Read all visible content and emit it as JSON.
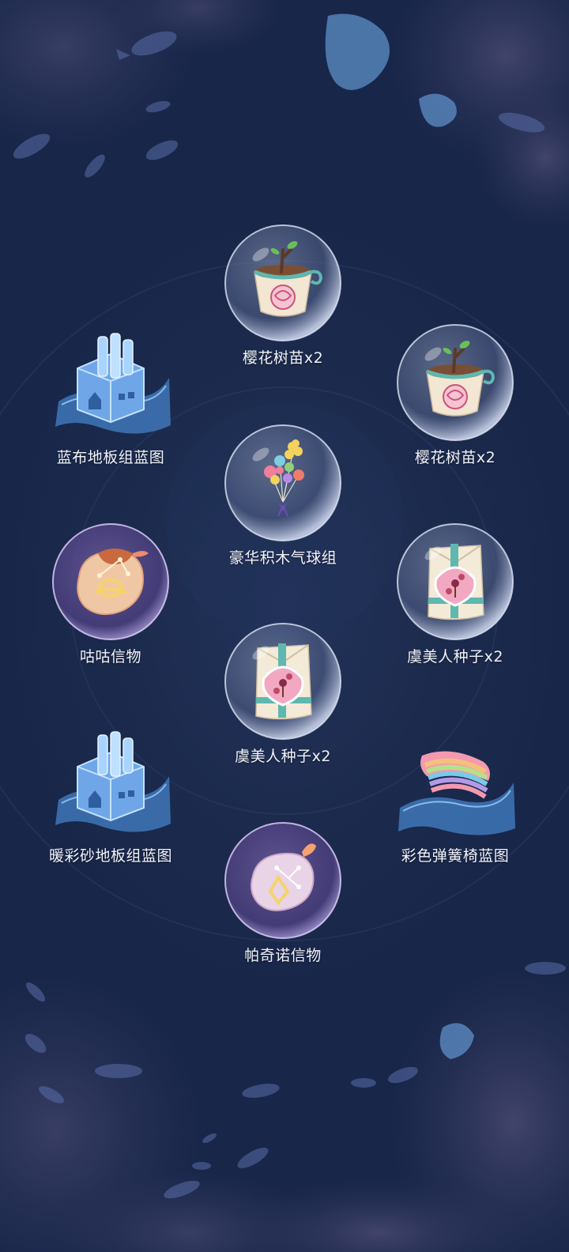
{
  "rewards": [
    {
      "id": "sakura-sapling-1",
      "label": "樱花树苗x2",
      "icon": "sakura-sapling-icon",
      "frame": "bubble"
    },
    {
      "id": "blue-cloth-floor-blueprint",
      "label": "蓝布地板组蓝图",
      "icon": "blue-cloth-floor-blueprint-icon",
      "frame": "blueprint"
    },
    {
      "id": "sakura-sapling-2",
      "label": "樱花树苗x2",
      "icon": "sakura-sapling-icon",
      "frame": "bubble"
    },
    {
      "id": "luxury-block-balloons",
      "label": "豪华积木气球组",
      "icon": "balloon-bunch-icon",
      "frame": "bubble"
    },
    {
      "id": "gugu-token",
      "label": "咕咕信物",
      "icon": "gugu-token-icon",
      "frame": "token"
    },
    {
      "id": "poppy-seed-1",
      "label": "虞美人种子x2",
      "icon": "poppy-seed-bag-icon",
      "frame": "bubble"
    },
    {
      "id": "poppy-seed-2",
      "label": "虞美人种子x2",
      "icon": "poppy-seed-bag-icon",
      "frame": "bubble"
    },
    {
      "id": "warm-sand-floor-blueprint",
      "label": "暖彩砂地板组蓝图",
      "icon": "warm-sand-floor-blueprint-icon",
      "frame": "blueprint"
    },
    {
      "id": "rainbow-spring-chair-blueprint",
      "label": "彩色弹簧椅蓝图",
      "icon": "rainbow-spring-chair-icon",
      "frame": "blueprint"
    },
    {
      "id": "pachino-token",
      "label": "帕奇诺信物",
      "icon": "pachino-token-icon",
      "frame": "token"
    }
  ]
}
